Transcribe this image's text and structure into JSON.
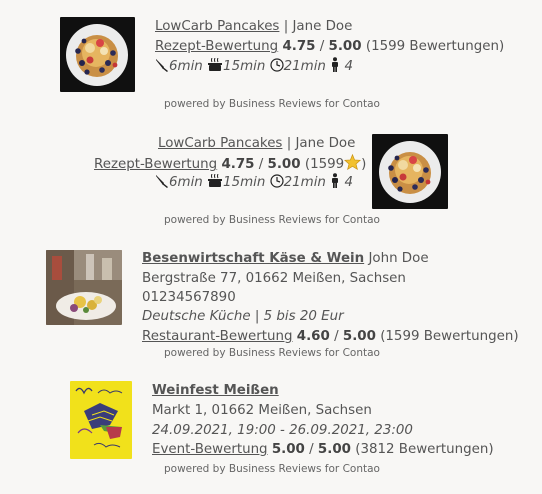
{
  "powered_by": "powered by Business Reviews for Contao",
  "recipe1": {
    "title": "LowCarb Pancakes",
    "separator": "|",
    "author": "Jane Doe",
    "rating_link": "Rezept-Bewertung",
    "score": "4.75",
    "slash": "/",
    "max": "5.00",
    "count": "(1599 Bewertungen)",
    "prep_time": "6min",
    "cook_time": "15min",
    "total_time": "21min",
    "servings": "4"
  },
  "recipe2": {
    "title": "LowCarb Pancakes",
    "separator": "|",
    "author": "Jane Doe",
    "rating_link": "Rezept-Bewertung",
    "score": "4.75",
    "slash": "/",
    "max": "5.00",
    "count_open": "(1599",
    "count_close": ")",
    "prep_time": "6min",
    "cook_time": "15min",
    "total_time": "21min",
    "servings": "4"
  },
  "restaurant": {
    "title": "Besenwirtschaft Käse & Wein",
    "owner": "John Doe",
    "address": "Bergstraße 77, 01662 Meißen, Sachsen",
    "phone": "01234567890",
    "cuisine": "Deutsche Küche | 5 bis 20 Eur",
    "rating_link": "Restaurant-Bewertung",
    "score": "4.60",
    "slash": "/",
    "max": "5.00",
    "count": "(1599 Bewertungen)"
  },
  "event": {
    "title": "Weinfest Meißen",
    "address": "Markt 1, 01662 Meißen, Sachsen",
    "dates": "24.09.2021, 19:00 - 26.09.2021, 23:00",
    "rating_link": "Event-Bewertung",
    "score": "5.00",
    "slash": "/",
    "max": "5.00",
    "count": "(3812 Bewertungen)"
  },
  "colors": {
    "background": "#f8f7f5",
    "text": "#555555",
    "star": "#f2c12e",
    "event_logo_bg": "#f1e11b"
  },
  "icons": [
    "knife-icon",
    "cooking-pot-icon",
    "clock-icon",
    "person-icon",
    "star-icon"
  ]
}
